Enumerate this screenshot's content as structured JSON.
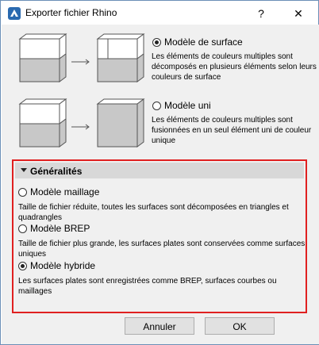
{
  "window": {
    "title": "Exporter fichier Rhino",
    "help_label": "?",
    "close_label": "✕"
  },
  "surface_option": {
    "label": "Modèle de surface",
    "selected": true,
    "description_lines": [
      "Les éléments de couleurs multiples sont",
      "décomposés en plusieurs éléments selon leurs",
      "couleurs de surface"
    ]
  },
  "solid_option": {
    "label": "Modèle uni",
    "selected": false,
    "description_lines": [
      "Les éléments de couleurs multiples sont",
      "fusionnées en un seul élément uni de couleur",
      "unique"
    ]
  },
  "general": {
    "title": "Généralités",
    "options": [
      {
        "label": "Modèle maillage",
        "selected": false,
        "description": "Taille de fichier réduite, toutes les surfaces sont décomposées en triangles et quadrangles"
      },
      {
        "label": "Modèle BREP",
        "selected": false,
        "description": "Taille de fichier plus grande, les surfaces plates sont conservées comme surfaces uniques"
      },
      {
        "label": "Modèle hybride",
        "selected": true,
        "description": "Les surfaces plates sont enregistrées comme BREP, surfaces courbes ou maillages"
      }
    ]
  },
  "buttons": {
    "cancel": "Annuler",
    "ok": "OK"
  },
  "colors": {
    "highlight_border": "#e02020",
    "group_header": "#d8d8d8",
    "dialog_bg": "#f0f0f0"
  }
}
